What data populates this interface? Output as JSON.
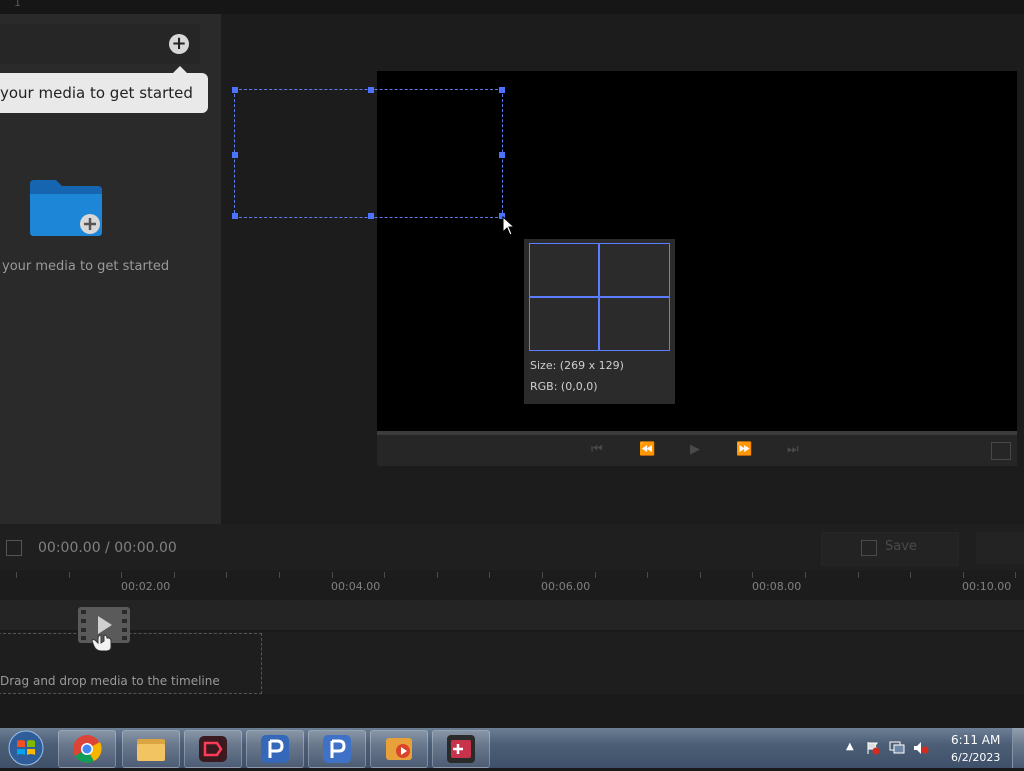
{
  "topbar": {
    "text": "1"
  },
  "media_panel": {
    "tooltip": "your media to get started",
    "hint": "your media to get started"
  },
  "color_picker": {
    "size": "Size: (269 x 129)",
    "rgb": "RGB: (0,0,0)"
  },
  "timeline": {
    "time_display": "00:00.00 / 00:00.00",
    "save_label": "Save",
    "ruler_labels": [
      "00:02.00",
      "00:04.00",
      "00:06.00",
      "00:08.00",
      "00:10.00"
    ],
    "drop_hint": "Drag and drop media to the timeline"
  },
  "taskbar": {
    "time": "6:11 AM",
    "date": "6/2/2023"
  },
  "colors": {
    "selection": "#5b7cf0",
    "accent_blue": "#4b73ff",
    "folder_blue": "#1e86d6"
  }
}
